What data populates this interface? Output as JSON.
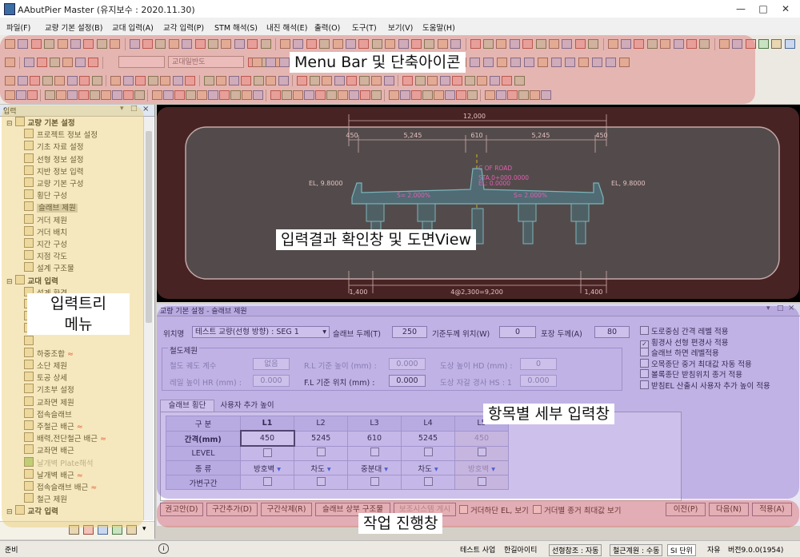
{
  "window": {
    "title": "AAbutPier Master  (유지보수 : 2020.11.30)"
  },
  "menu": [
    "파일(F)",
    "교량 기본 설정(B)",
    "교대 입력(A)",
    "교각 입력(P)",
    "STM 해석(S)",
    "내진 해석(E)",
    "출력(O)",
    "도구(T)",
    "보기(V)",
    "도움말(H)"
  ],
  "toolbar": {
    "combo_value": "교대일반도"
  },
  "annotations": {
    "menubar": "Menu Bar 및 단축아이콘",
    "drawing": "입력결과 확인창 및 도면View",
    "tree": "입력트리\n메뉴",
    "detail": "항목별 세부 입력창",
    "progress": "작업 진행창"
  },
  "left_panel": {
    "title": "입력",
    "items": [
      {
        "label": "교량 기본 설정",
        "level": 0
      },
      {
        "label": "프로젝트 정보 설정",
        "level": 1
      },
      {
        "label": "기초 자료 설정",
        "level": 1
      },
      {
        "label": "선형 정보 설정",
        "level": 1
      },
      {
        "label": "지반 정보 입력",
        "level": 1
      },
      {
        "label": "교량 기본 구성",
        "level": 1
      },
      {
        "label": "횡단 구성",
        "level": 1
      },
      {
        "label": "슬래브 제원",
        "level": 1,
        "selected": true
      },
      {
        "label": "거더 제원",
        "level": 1
      },
      {
        "label": "거더 배치",
        "level": 1
      },
      {
        "label": "지간 구성",
        "level": 1
      },
      {
        "label": "지점 각도",
        "level": 1
      },
      {
        "label": "설계 구조물",
        "level": 1
      },
      {
        "label": "교대 입력",
        "level": 0
      },
      {
        "label": "설계 환경",
        "level": 1
      },
      {
        "label": "",
        "level": 1
      },
      {
        "label": "",
        "level": 1
      },
      {
        "label": "",
        "level": 1
      },
      {
        "label": "",
        "level": 1
      },
      {
        "label": "하중조합",
        "level": 1,
        "flag": true
      },
      {
        "label": "소단 제원",
        "level": 1
      },
      {
        "label": "토공 상세",
        "level": 1
      },
      {
        "label": "기초부 설정",
        "level": 1
      },
      {
        "label": "교좌면 제원",
        "level": 1
      },
      {
        "label": "접속슬래브",
        "level": 1
      },
      {
        "label": "주철근 배근",
        "level": 1,
        "flag": true
      },
      {
        "label": "배력,전단철근 배근",
        "level": 1,
        "flag": true
      },
      {
        "label": "교좌면 배근",
        "level": 1
      },
      {
        "label": "날개벽 Plate해석",
        "level": 1,
        "disabled": true
      },
      {
        "label": "날개벽 배근",
        "level": 1,
        "flag": true
      },
      {
        "label": "접속슬래브 배근",
        "level": 1,
        "flag": true
      },
      {
        "label": "철근 제원",
        "level": 1
      },
      {
        "label": "교각 입력",
        "level": 0
      }
    ]
  },
  "drawing": {
    "top_total": "12,000",
    "top_dims": [
      "450",
      "5,245",
      "610",
      "5,245",
      "450"
    ],
    "label_road": "C OF ROAD",
    "label_sta": "STA.0+000.0000",
    "label_el": "EL: 0.0000",
    "left_el": "EL, 9.8000",
    "right_el": "EL, 9.8000",
    "slope_left": "S= 2.000%",
    "slope_right": "S= 2.000%",
    "bot_left": "1,400",
    "bot_mid": "4@2,300=9,200",
    "bot_right": "1,400"
  },
  "detail": {
    "panel_title": "교량 기본 설정 - 슬래브 제원",
    "position_label": "위치명",
    "position_value": "테스트 교량(선형 방향) : SEG 1",
    "slab_thk_label": "슬래브 두께(T)",
    "slab_thk_value": "250",
    "base_pos_label": "기준두께 위치(W)",
    "base_pos_value": "0",
    "pave_label": "포장 두께(A)",
    "pave_value": "80",
    "rail_group": "철도제원",
    "rail_type_label": "철도 궤도 계수",
    "rail_type_value": "없음",
    "rl_label": "R.L 기준 높이 (mm) :",
    "rl_value": "0.000",
    "dosang_hd_label": "도상 높이 HD (mm) :",
    "dosang_hd_value": "0",
    "rail_hr_label": "레일 높이 HR (mm) :",
    "rail_hr_value": "0.000",
    "fl_label": "F.L 기준 위치 (mm) :",
    "fl_value": "0.000",
    "dosang_hs_label": "도상 자갈 경사 HS : 1",
    "dosang_hs_value": "0.000",
    "options": [
      {
        "label": "도로중심 간격 레벨 적용",
        "checked": false
      },
      {
        "label": "횡경사 선형 편경사 적용",
        "checked": true
      },
      {
        "label": "슬래브 하면 레벨적용",
        "checked": false
      },
      {
        "label": "오목종단 중거 최대값 자동 적용",
        "checked": false
      },
      {
        "label": "볼록종단 받침위치 종거 적용",
        "checked": false
      },
      {
        "label": "받침EL 산출시 사용자 추가 높이 적용",
        "checked": false
      }
    ],
    "tabs": [
      "슬래브 횡단",
      "사용자 추가 높이"
    ],
    "grid": {
      "header": [
        "구 분",
        "L1",
        "L2",
        "L3",
        "L4",
        "L5"
      ],
      "rows": [
        {
          "label": "간격(mm)",
          "values": [
            "450",
            "5245",
            "610",
            "5245",
            "450"
          ]
        },
        {
          "label": "LEVEL",
          "values": [
            "",
            "",
            "",
            "",
            ""
          ]
        },
        {
          "label": "종 류",
          "values": [
            "방호벽",
            "차도",
            "중분대",
            "차도",
            "방호벽"
          ]
        },
        {
          "label": "가변구간",
          "values": [
            "",
            "",
            "",
            "",
            ""
          ]
        }
      ]
    },
    "bottom_buttons": [
      "권고안(D)",
      "구간추가(D)",
      "구간삭제(R)",
      "슬래브 상부 구조물",
      "보조시스템 게시"
    ],
    "bottom_checks": [
      "거더하단 EL, 보기",
      "거더별 종거 최대값 보기"
    ],
    "nav_buttons": [
      "이전(P)",
      "다음(N)",
      "적용(A)"
    ]
  },
  "status": {
    "left": "준비",
    "items": [
      "테스트 사업",
      "한길아이티",
      "선형참조 : 자동",
      "철근계원 : 수동",
      "SI 단위",
      "자유",
      "버전9.0.0(1954)"
    ]
  }
}
